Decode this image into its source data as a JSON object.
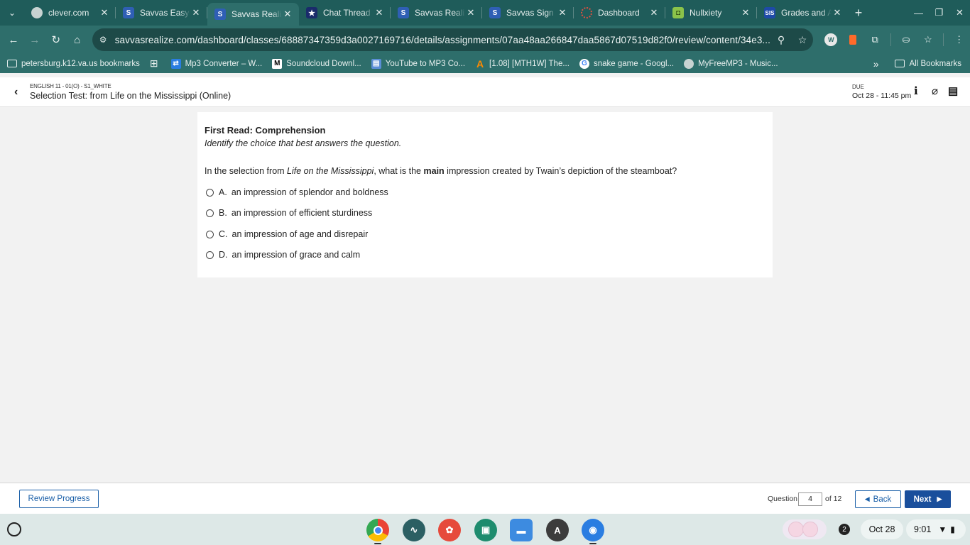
{
  "browser": {
    "tabs": [
      {
        "title": "clever.com",
        "favicon": "globe-icon"
      },
      {
        "title": "Savvas EasyBridge",
        "favicon": "savvas-icon"
      },
      {
        "title": "Savvas Realize",
        "favicon": "savvas-icon",
        "active": true
      },
      {
        "title": "Chat Thread",
        "favicon": "star-icon"
      },
      {
        "title": "Savvas Realize",
        "favicon": "savvas-icon"
      },
      {
        "title": "Savvas Sign In",
        "favicon": "savvas-icon"
      },
      {
        "title": "Dashboard",
        "favicon": "dashboard-icon"
      },
      {
        "title": "Nullxiety",
        "favicon": "nullxiety-icon"
      },
      {
        "title": "Grades and Attendance",
        "favicon": "sis-icon",
        "favicon_text": "SIS"
      }
    ],
    "url": "savvasrealize.com/dashboard/classes/68887347359d3a0027169716/details/assignments/07aa48aa266847daa5867d07519d82f0/review/content/34e3...",
    "bookmarks": [
      {
        "label": "petersburg.k12.va.us bookmarks",
        "icon": "managed-folder-icon"
      },
      {
        "label": "Mp3 Converter – W...",
        "icon": "converter-icon"
      },
      {
        "label": "Soundcloud Downl...",
        "icon": "m-icon"
      },
      {
        "label": "YouTube to MP3 Co...",
        "icon": "yt-icon"
      },
      {
        "label": "[1.08] [MTH1W] The...",
        "icon": "a-icon"
      },
      {
        "label": "snake game - Googl...",
        "icon": "google-icon"
      },
      {
        "label": "MyFreeMP3 - Music...",
        "icon": "globe-icon"
      }
    ],
    "all_bookmarks": "All Bookmarks"
  },
  "header": {
    "course": "ENGLISH 11 - 01(O) - S1_WHITE",
    "title": "Selection Test: from Life on the Mississippi (Online)",
    "due_label": "DUE",
    "due_date": "Oct 28 - 11:45 pm"
  },
  "question": {
    "heading": "First Read: Comprehension",
    "instruction": "Identify the choice that best answers the question.",
    "prompt_parts": [
      "In the selection from ",
      "Life on the Mississippi",
      ", what is the ",
      "main",
      " impression created by Twain’s depiction of the steamboat?"
    ],
    "options": [
      {
        "letter": "A.",
        "text": "an impression of splendor and boldness"
      },
      {
        "letter": "B.",
        "text": "an impression of efficient sturdiness"
      },
      {
        "letter": "C.",
        "text": "an impression of age and disrepair"
      },
      {
        "letter": "D.",
        "text": "an impression of grace and calm"
      }
    ]
  },
  "footer": {
    "review_progress": "Review Progress",
    "question_label": "Question",
    "current_question": "4",
    "of_total": "of 12",
    "back": "Back",
    "next": "Next"
  },
  "shelf": {
    "notifications": "2",
    "date": "Oct 28",
    "time": "9:01",
    "account_letter": "A"
  }
}
